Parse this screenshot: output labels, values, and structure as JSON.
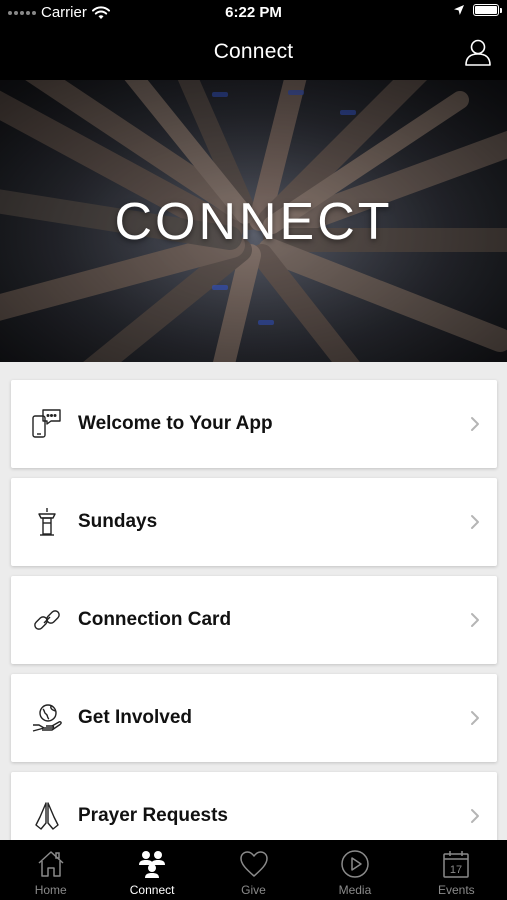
{
  "status_bar": {
    "carrier": "Carrier",
    "time": "6:22 PM"
  },
  "nav": {
    "title": "Connect"
  },
  "hero": {
    "title": "CONNECT"
  },
  "menu_items": [
    {
      "label": "Welcome to Your App",
      "icon": "chat-phone-icon"
    },
    {
      "label": "Sundays",
      "icon": "pulpit-icon"
    },
    {
      "label": "Connection Card",
      "icon": "link-icon"
    },
    {
      "label": "Get Involved",
      "icon": "helping-hand-globe-icon"
    },
    {
      "label": "Prayer Requests",
      "icon": "praying-hands-icon"
    }
  ],
  "tabs": [
    {
      "label": "Home",
      "icon": "home-icon",
      "active": false
    },
    {
      "label": "Connect",
      "icon": "people-icon",
      "active": true
    },
    {
      "label": "Give",
      "icon": "heart-icon",
      "active": false
    },
    {
      "label": "Media",
      "icon": "play-icon",
      "active": false
    },
    {
      "label": "Events",
      "icon": "calendar-icon",
      "active": false
    }
  ],
  "calendar_day": "17",
  "colors": {
    "bar_background": "#000000",
    "list_background": "#ececec",
    "tab_inactive": "#8a8a8a",
    "tab_active": "#ffffff"
  }
}
